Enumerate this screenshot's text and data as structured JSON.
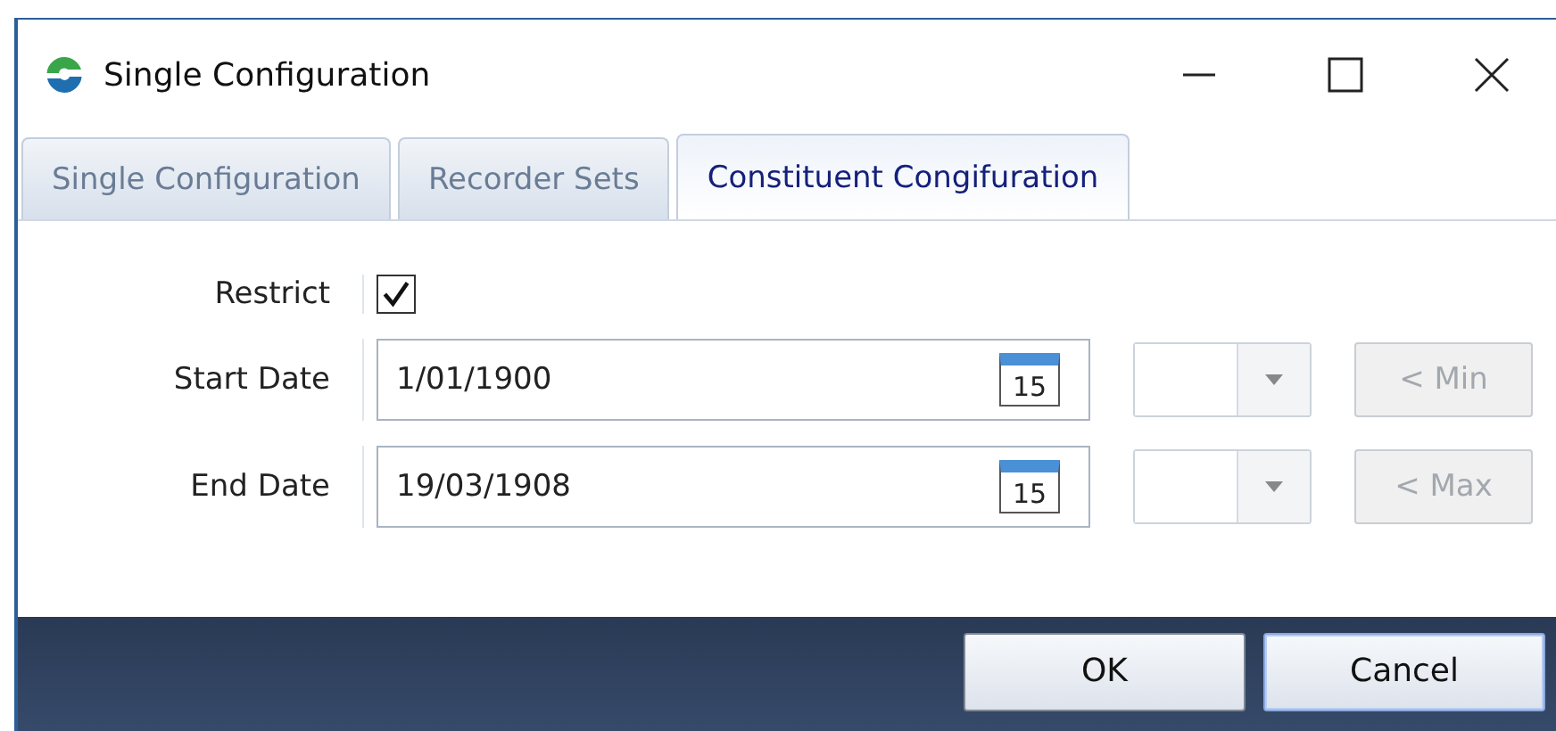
{
  "window": {
    "title": "Single Configuration"
  },
  "tabs": [
    {
      "label": "Single Configuration",
      "selected": false
    },
    {
      "label": "Recorder Sets",
      "selected": false
    },
    {
      "label": "Constituent Congifuration",
      "selected": true
    }
  ],
  "restrict": {
    "label": "Restrict",
    "checked": true
  },
  "dates": [
    {
      "label": "Start Date",
      "value": "1/01/1900",
      "calendar_day": "15",
      "button": "< Min",
      "disabled": true
    },
    {
      "label": "End Date",
      "value": "19/03/1908",
      "calendar_day": "15",
      "button": "< Max",
      "disabled": true
    }
  ],
  "buttons": [
    {
      "label": "OK",
      "focused": false
    },
    {
      "label": "Cancel",
      "focused": true
    }
  ]
}
